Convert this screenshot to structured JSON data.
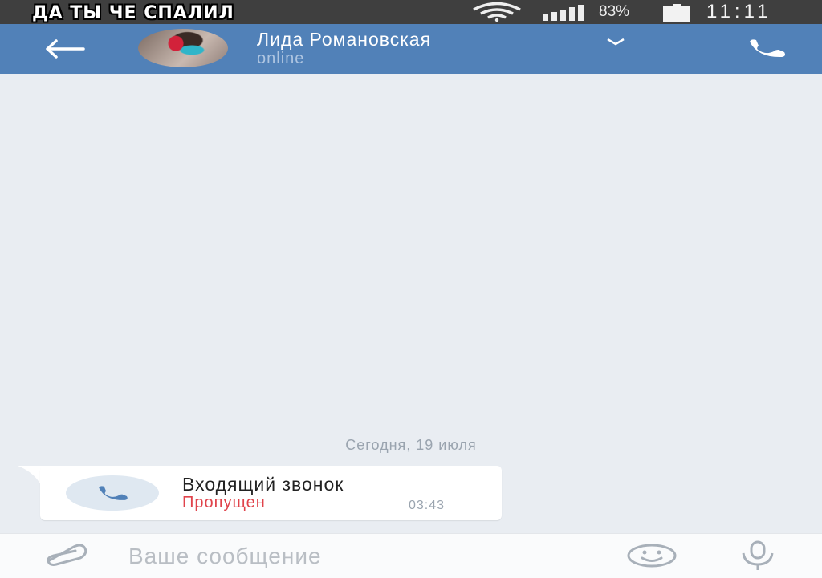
{
  "status_bar": {
    "meme_caption": "ДА ТЫ ЧЕ СПАЛИЛ",
    "battery_percent": "83%",
    "time": "11:11",
    "icons": [
      "wifi-icon",
      "signal-icon",
      "battery-icon"
    ]
  },
  "header": {
    "contact_name": "Лида Романовская",
    "status": "online",
    "icons": [
      "back-arrow-icon",
      "chevron-down-icon",
      "phone-icon"
    ]
  },
  "chat": {
    "date_separator": "Сегодня, 19 июля",
    "messages": [
      {
        "type": "call",
        "title": "Входящий звонок",
        "state": "Пропущен",
        "time": "03:43",
        "icon": "phone-icon"
      }
    ]
  },
  "input": {
    "placeholder": "Ваше сообщение",
    "value": "",
    "icons": [
      "paperclip-icon",
      "smile-icon",
      "microphone-icon"
    ]
  },
  "colors": {
    "header": "#5181b8",
    "background": "#e9edf2",
    "missed": "#e0434b",
    "status_bar": "#3f3f3f"
  }
}
